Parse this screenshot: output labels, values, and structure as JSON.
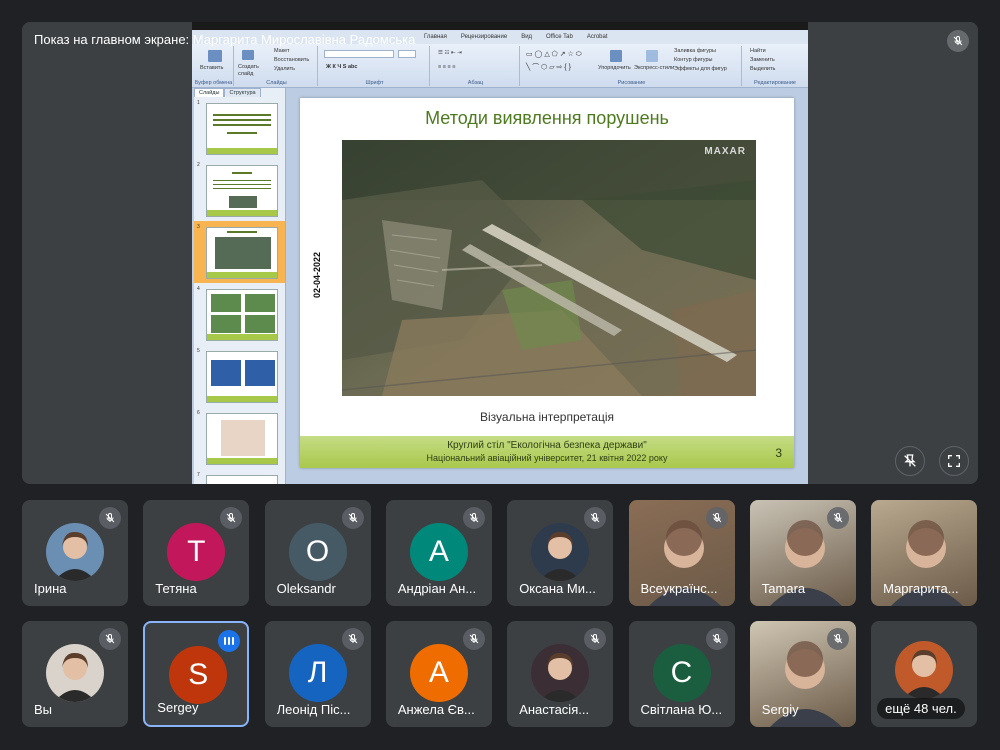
{
  "stage": {
    "presenter_label": "Показ на главном экране: Маргарита Мирославівна Радомська"
  },
  "ppt": {
    "menu": [
      "Главная",
      "Рецензирование",
      "Вид",
      "Office Tab",
      "Acrobat"
    ],
    "ribbon": {
      "paste": "Вставить",
      "create_slide": "Создать слайд",
      "layout": "Макет",
      "restore": "Восстановить",
      "delete": "Удалить",
      "clipboard_group": "Буфер обмена",
      "slides_group": "Слайды",
      "font_group": "Шрифт",
      "paragraph_group": "Абзац",
      "arrange": "Упорядочить",
      "quick_styles": "Экспресс-стили",
      "shape_fill": "Заливка фигуры",
      "shape_outline": "Контур фигуры",
      "shape_effects": "Эффекты для фигур",
      "drawing_group": "Рисование",
      "find": "Найти",
      "replace": "Заменить",
      "select": "Выделить",
      "editing_group": "Редактирование"
    },
    "panel_tabs": [
      "Слайды",
      "Структура"
    ],
    "thumb_numbers": [
      "1",
      "2",
      "3",
      "4",
      "5",
      "6",
      "7"
    ],
    "slide": {
      "title": "Методи виявлення порушень",
      "image_watermark": "MAXAR",
      "date": "02-04-2022",
      "caption": "Візуальна інтерпретація",
      "footer_line1": "Круглий стіл \"Екологічна безпека держави\"",
      "footer_line2": "Національний авіаційний університет, 21 квітня 2022 року",
      "number": "3"
    }
  },
  "participants": [
    {
      "name": "Ірина",
      "avatar": "photo",
      "color": "#6a8fb3",
      "muted": true
    },
    {
      "name": "Тетяна",
      "avatar": "T",
      "color": "#c2185b",
      "muted": true
    },
    {
      "name": "Oleksandr",
      "avatar": "O",
      "color": "#455a64",
      "muted": true
    },
    {
      "name": "Андріан Ан...",
      "avatar": "A",
      "color": "#00897b",
      "muted": true
    },
    {
      "name": "Оксана Ми...",
      "avatar": "photo",
      "color": "#2d3b4d",
      "muted": true
    },
    {
      "name": "Всеукраїнс...",
      "avatar": "video",
      "color": "#8a6d55",
      "muted": true
    },
    {
      "name": "Tamara",
      "avatar": "video",
      "color": "#c9c3b5",
      "muted": true
    },
    {
      "name": "Маргарита...",
      "avatar": "video",
      "color": "#b9a98f",
      "muted": false
    },
    {
      "name": "Вы",
      "avatar": "photo",
      "color": "#d9d3cc",
      "muted": true
    },
    {
      "name": "Sergey",
      "avatar": "S",
      "color": "#bf360c",
      "muted": false,
      "speaking": true
    },
    {
      "name": "Леонід Піс...",
      "avatar": "Л",
      "color": "#1565c0",
      "muted": true
    },
    {
      "name": "Анжела Єв...",
      "avatar": "A",
      "color": "#ef6c00",
      "muted": true
    },
    {
      "name": "Анастасія...",
      "avatar": "photo",
      "color": "#3b2f35",
      "muted": true
    },
    {
      "name": "Світлана Ю...",
      "avatar": "C",
      "color": "#1b5e3f",
      "muted": true
    },
    {
      "name": "Sergiy",
      "avatar": "video",
      "color": "#cfc6b3",
      "muted": true
    },
    {
      "name": "ещё 48 чел.",
      "avatar": "photo",
      "color": "#c05a2a",
      "muted": false,
      "more": true
    }
  ],
  "icons": {
    "stage_mic": "mic-off-icon",
    "unpin": "unpin-icon",
    "fullscreen": "fullscreen-icon"
  }
}
